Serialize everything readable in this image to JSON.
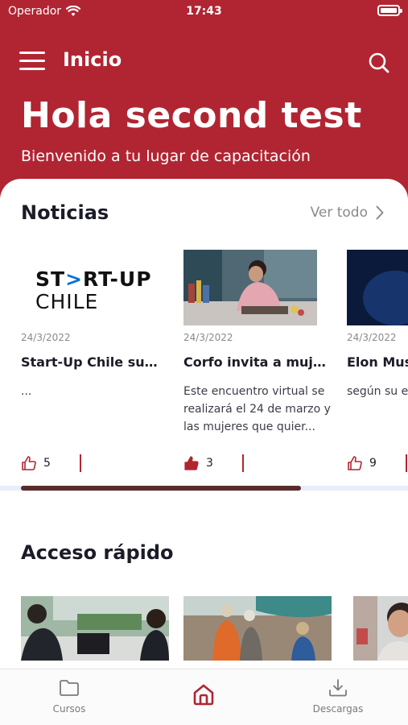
{
  "status_bar": {
    "carrier": "Operador",
    "time": "17:43"
  },
  "nav": {
    "title": "Inicio"
  },
  "hero": {
    "greeting": "Hola second test",
    "subtitle": "Bienvenido a tu lugar de capacitación"
  },
  "news": {
    "title": "Noticias",
    "see_all": "Ver todo",
    "items": [
      {
        "logo_line1": "ST",
        "logo_arrow": ">",
        "logo_line1b": "RT-UP",
        "logo_line2": "CHILE",
        "date": "24/3/2022",
        "title": "Start-Up Chile sum...",
        "desc": "...",
        "likes": "5"
      },
      {
        "date": "24/3/2022",
        "title": "Corfo invita a muje...",
        "desc": "Este encuentro virtual se realizará el 24 de marzo y las mujeres que quier...",
        "likes": "3"
      },
      {
        "date": "24/3/2022",
        "title": "Elon Musk",
        "desc": "según su e",
        "likes": "9"
      }
    ]
  },
  "quick_access": {
    "title": "Acceso rápido"
  },
  "tabbar": {
    "courses": "Cursos",
    "downloads": "Descargas"
  },
  "colors": {
    "brand": "#b12532",
    "scroll_thumb": "#5a2b2b"
  }
}
